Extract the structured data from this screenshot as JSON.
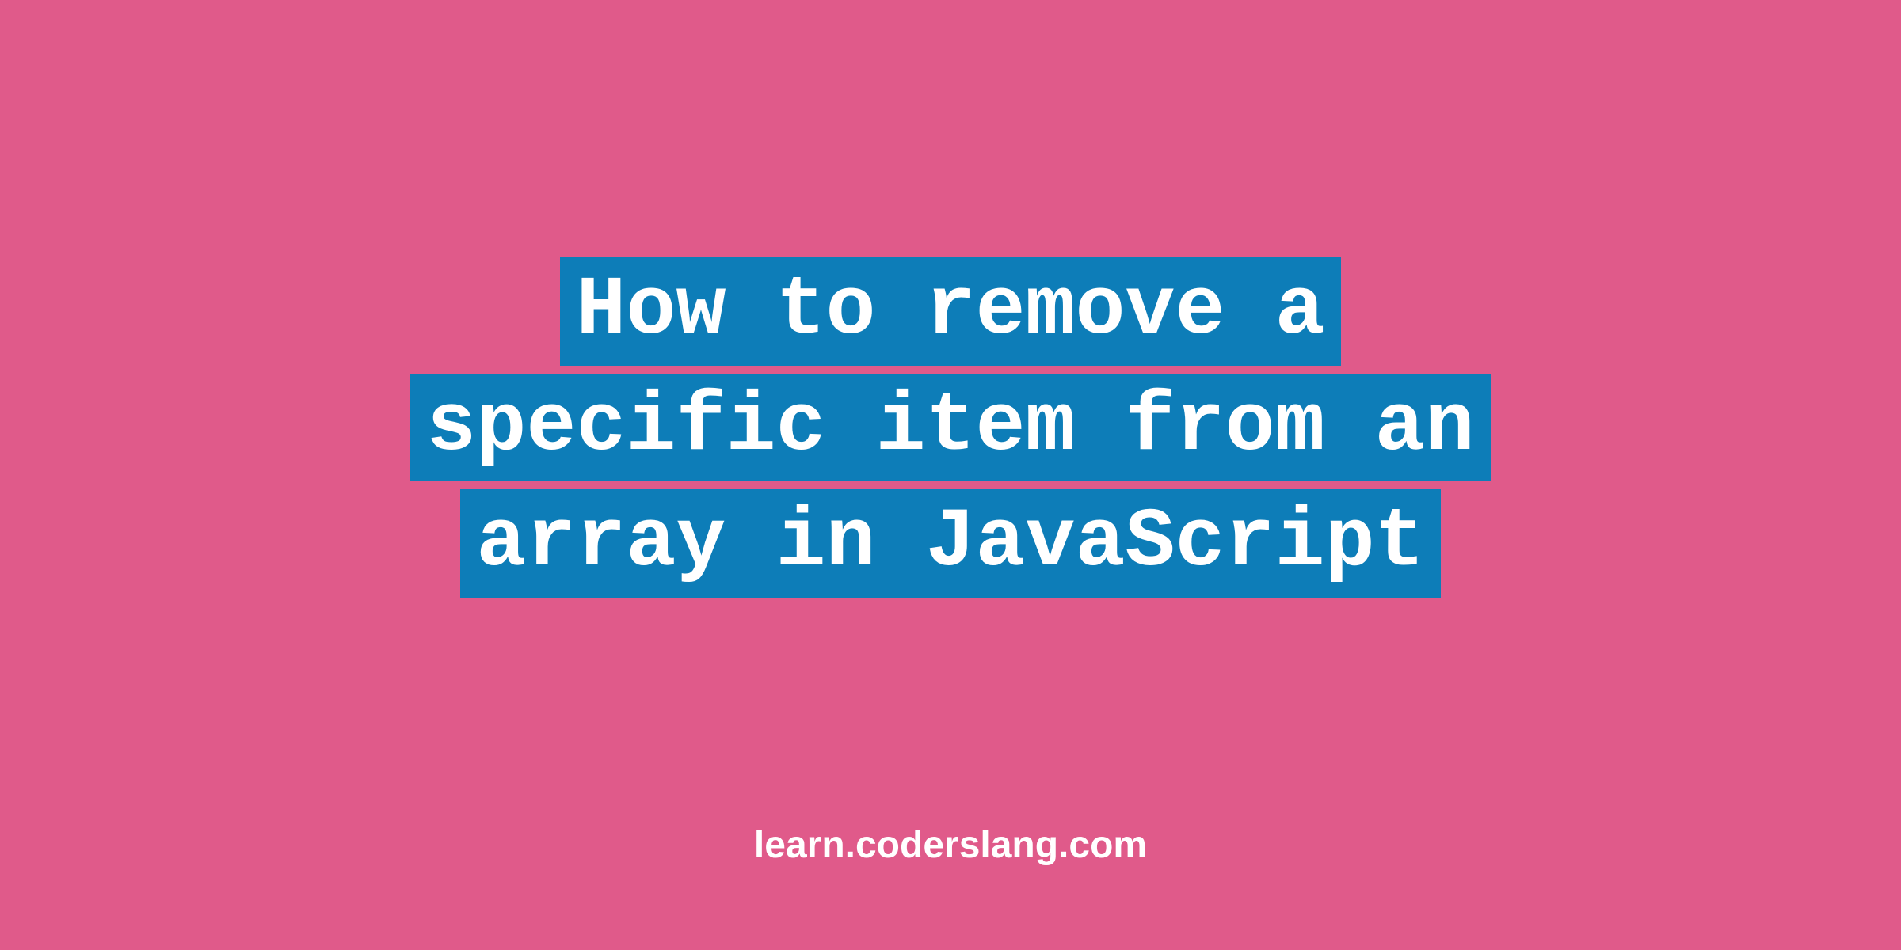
{
  "title": {
    "line1": "How to remove a",
    "line2": "specific item from an",
    "line3": "array in JavaScript"
  },
  "footer": "learn.coderslang.com",
  "colors": {
    "background": "#e05a8a",
    "highlight": "#0d7db8",
    "text": "#ffffff"
  }
}
